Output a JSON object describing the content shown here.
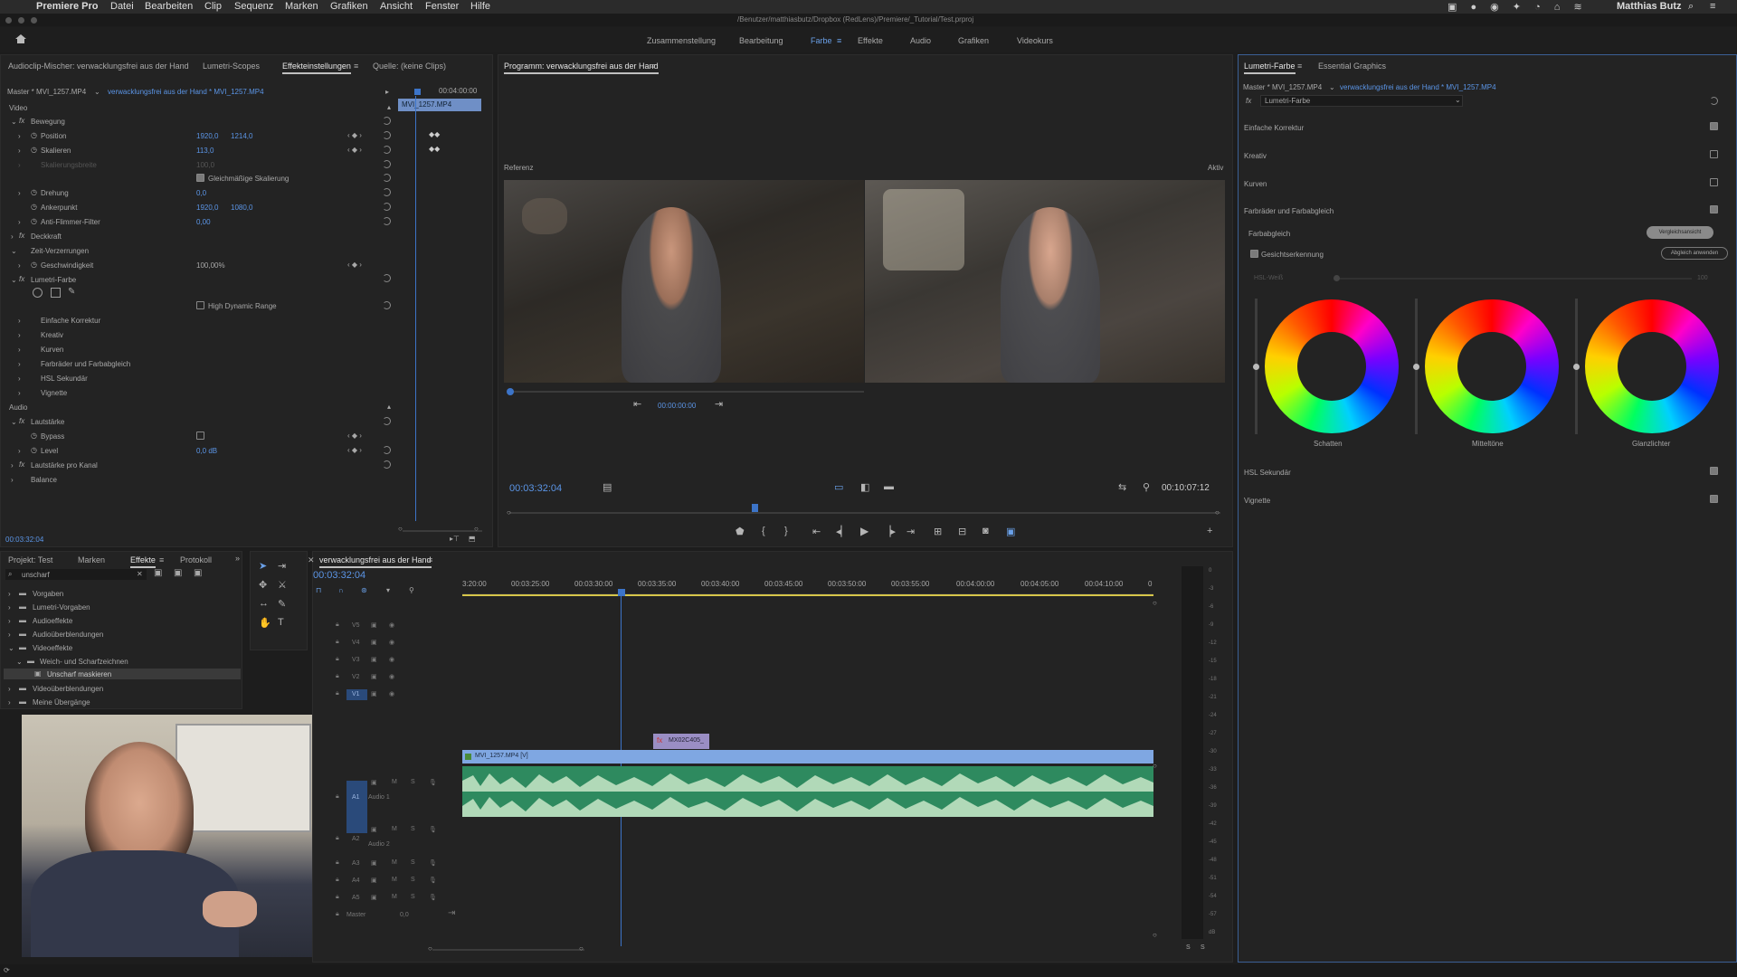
{
  "menubar": {
    "app_name": "Premiere Pro",
    "items": [
      "Datei",
      "Bearbeiten",
      "Clip",
      "Sequenz",
      "Marken",
      "Grafiken",
      "Ansicht",
      "Fenster",
      "Hilfe"
    ],
    "user": "Matthias Butz"
  },
  "title_path": "/Benutzer/matthiasbutz/Dropbox (RedLens)/Premiere/_Tutorial/Test.prproj",
  "workspaces": [
    "Zusammenstellung",
    "Bearbeitung",
    "Farbe",
    "Effekte",
    "Audio",
    "Grafiken",
    "Videokurs"
  ],
  "workspace_active": "Farbe",
  "left_panel": {
    "tabs": [
      "Audioclip-Mischer: verwacklungsfrei aus der Hand",
      "Lumetri-Scopes",
      "Effekteinstellungen",
      "Quelle: (keine Clips)"
    ],
    "master_label": "Master * MVI_1257.MP4",
    "clip_label": "verwacklungsfrei aus der Hand * MVI_1257.MP4",
    "time_right": "00:04:00:00",
    "clip_bar": "MVI_1257.MP4",
    "section_video": "Video",
    "bewegung": "Bewegung",
    "position": {
      "label": "Position",
      "x": "1920,0",
      "y": "1214,0"
    },
    "skalieren": {
      "label": "Skalieren",
      "value": "113,0"
    },
    "skalierungsbreite": {
      "label": "Skalierungsbreite",
      "value": "100,0"
    },
    "gleichmaessig": "Gleichmäßige Skalierung",
    "drehung": {
      "label": "Drehung",
      "value": "0,0"
    },
    "ankerpunkt": {
      "label": "Ankerpunkt",
      "x": "1920,0",
      "y": "1080,0"
    },
    "antiflimmer": {
      "label": "Anti-Flimmer-Filter",
      "value": "0,00"
    },
    "deckkraft": "Deckkraft",
    "zeitverzerrung": "Zeit-Verzerrungen",
    "geschwindigkeit": {
      "label": "Geschwindigkeit",
      "value": "100,00%"
    },
    "lumetri_farbe": "Lumetri-Farbe",
    "hdr": "High Dynamic Range",
    "lumetri_items": [
      "Einfache Korrektur",
      "Kreativ",
      "Kurven",
      "Farbräder und Farbabgleich",
      "HSL Sekundär",
      "Vignette"
    ],
    "section_audio": "Audio",
    "lautstaerke": "Lautstärke",
    "bypass": "Bypass",
    "level": {
      "label": "Level",
      "value": "0,0 dB"
    },
    "lautstaerke_kanal": "Lautstärke pro Kanal",
    "balance": "Balance",
    "timecode": "00:03:32:04"
  },
  "program_monitor": {
    "title": "Programm: verwacklungsfrei aus der Hand",
    "referenz": "Referenz",
    "aktiv": "Aktiv",
    "ref_timecode": "00:00:00:00",
    "timecode": "00:03:32:04",
    "duration": "00:10:07:12"
  },
  "lumetri_panel": {
    "tabs": [
      "Lumetri-Farbe",
      "Essential Graphics"
    ],
    "master_label": "Master * MVI_1257.MP4",
    "clip_label": "verwacklungsfrei aus der Hand * MVI_1257.MP4",
    "fx_label": "Lumetri-Farbe",
    "sections": [
      {
        "label": "Einfache Korrektur",
        "checked": true
      },
      {
        "label": "Kreativ",
        "checked": false
      },
      {
        "label": "Kurven",
        "checked": false
      },
      {
        "label": "Farbräder und Farbabgleich",
        "checked": true
      }
    ],
    "farbabgleich": "Farbabgleich",
    "vergleich_button": "Vergleichsansicht",
    "gesichtserkennung": "Gesichtserkennung",
    "abgleich_button": "Abgleich anwenden",
    "hsl_weiss": "HSL-Weiß",
    "hsl_weiss_value": "100",
    "wheels": [
      "Schatten",
      "Mitteltöne",
      "Glanzlichter"
    ],
    "hsl_sekundaer": "HSL Sekundär",
    "vignette": "Vignette"
  },
  "project_panel": {
    "tabs": [
      "Projekt: Test",
      "Marken",
      "Effekte",
      "Protokoll"
    ],
    "search_value": "unscharf",
    "tree": [
      {
        "label": "Vorgaben",
        "indent": 0
      },
      {
        "label": "Lumetri-Vorgaben",
        "indent": 0
      },
      {
        "label": "Audioeffekte",
        "indent": 0
      },
      {
        "label": "Audioüberblendungen",
        "indent": 0
      },
      {
        "label": "Videoeffekte",
        "indent": 0
      },
      {
        "label": "Weich- und Scharfzeichnen",
        "indent": 1
      },
      {
        "label": "Unscharf maskieren",
        "indent": 2
      },
      {
        "label": "Videoüberblendungen",
        "indent": 0
      },
      {
        "label": "Meine Übergänge",
        "indent": 0
      }
    ]
  },
  "timeline": {
    "title": "verwacklungsfrei aus der Hand",
    "timecode": "00:03:32:04",
    "ruler": [
      "3:20:00",
      "00:03:25:00",
      "00:03:30:00",
      "00:03:35:00",
      "00:03:40:00",
      "00:03:45:00",
      "00:03:50:00",
      "00:03:55:00",
      "00:04:00:00",
      "00:04:05:00",
      "00:04:10:00"
    ],
    "video_tracks": [
      "V5",
      "V4",
      "V3",
      "V2",
      "V1"
    ],
    "audio_tracks": [
      "A1",
      "A2",
      "A3",
      "A4",
      "A5"
    ],
    "audio1_label": "Audio 1",
    "audio2_label": "Audio 2",
    "master_label": "Master",
    "master_value": "0,0",
    "clip_v1": "MVI_1257.MP4 [V]",
    "clip_v2": "MX02C405_",
    "meter_scale": [
      "0",
      "-3",
      "-6",
      "-9",
      "-12",
      "-15",
      "-18",
      "-21",
      "-24",
      "-27",
      "-30",
      "-33",
      "-36",
      "-39",
      "-42",
      "-45",
      "-48",
      "-51",
      "-54",
      "-57",
      "dB"
    ],
    "meter_bottom": [
      "S",
      "S"
    ]
  }
}
